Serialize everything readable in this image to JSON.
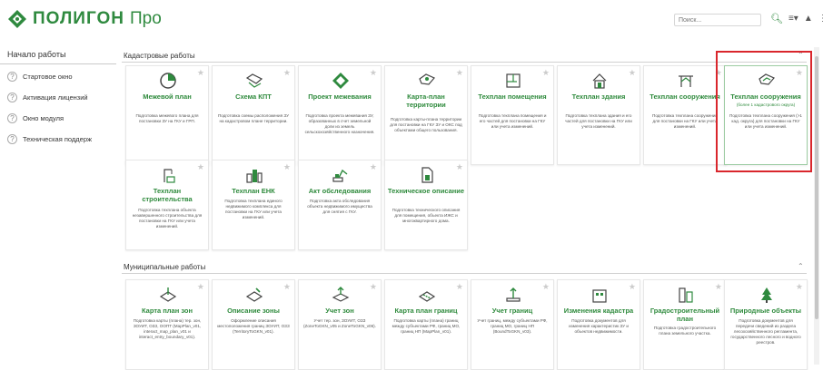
{
  "header": {
    "brand": "ПОЛИГОН",
    "brand_suffix": "Про",
    "search_placeholder": "Поиск...",
    "colors": {
      "brand": "#2f8a3f",
      "highlight": "#d9262c"
    }
  },
  "sidebar": {
    "title": "Начало работы",
    "items": [
      {
        "label": "Стартовое окно"
      },
      {
        "label": "Активация лицензий"
      },
      {
        "label": "Окно модуля"
      },
      {
        "label": "Техническая поддерж"
      }
    ]
  },
  "sections": {
    "cadastral": {
      "title": "Кадастровые работы",
      "cards": [
        {
          "title": "Межевой план",
          "desc": "Подготовка межевого плана для постановки ЗУ на ГКУ и ГРП.",
          "icon": "pie-chart-icon"
        },
        {
          "title": "Схема КПТ",
          "desc": "Подготовка схемы расположения ЗУ на кадастровом плане территории.",
          "icon": "map-icon"
        },
        {
          "title": "Проект межевания",
          "desc": "Подготовка проекта межевания ЗУ, образованных в счет земельной доли из земель сельскохозяйственного назначения.",
          "icon": "diamond-map-icon"
        },
        {
          "title": "Карта-план территории",
          "desc": "Подготовка карты-плана территории для постановки на ГКУ ЗУ и ОКС под объектами общего пользования.",
          "icon": "territory-map-icon"
        },
        {
          "title": "Техплан помещения",
          "desc": "Подготовка техплана помещения и его частей для постановки на ГКУ или учета изменений.",
          "icon": "room-plan-icon"
        },
        {
          "title": "Техплан здания",
          "desc": "Подготовка техплана здания и его частей для постановки на ГКУ или учета изменений.",
          "icon": "house-icon"
        },
        {
          "title": "Техплан сооружения",
          "desc": "Подготовка техплана сооружения для постановки на ГКУ или учета изменений.",
          "icon": "structure-icon"
        },
        {
          "title": "Техплан сооружения",
          "subtitle": "(более 1 кадастрового округа)",
          "desc": "Подготовка техплана сооружения (>1 кад. округа) для постановки на ГКУ или учета изменений.",
          "icon": "map-multi-icon"
        },
        {
          "title": "Техплан строительства",
          "desc": "Подготовка техплана объекта незавершенного строительства для постановки на ГКУ или учета изменений.",
          "icon": "construction-icon"
        },
        {
          "title": "Техплан ЕНК",
          "desc": "Подготовка техплана единого недвижимого комплекса для постановки на ГКУ или учета изменений.",
          "icon": "complex-icon"
        },
        {
          "title": "Акт обследования",
          "desc": "Подготовка акта обследования объекта недвижимого имущества для снятия с ГКУ.",
          "icon": "excavator-icon"
        },
        {
          "title": "Техническое описание",
          "desc": "Подготовка технического описания для помещения, объекта ИЖС и многоквартирного дома.",
          "icon": "document-icon"
        }
      ]
    },
    "municipal": {
      "title": "Муниципальные работы",
      "cards": [
        {
          "title": "Карта план зон",
          "desc": "Подготовка карты (плана) тер. зон, ЗОУИТ, ОЗЗ, ООПТ (MapPlan_v01, interact_map_plan_v01 и interact_entry_boundary_v01).",
          "icon": "zone-map-icon"
        },
        {
          "title": "Описание зоны",
          "desc": "Оформление описания местоположения границ ЗОУИТ, ОЗЗ (TerritoryToGKN_v01).",
          "icon": "zone-desc-icon"
        },
        {
          "title": "Учет зон",
          "desc": "Учет тер. зон, ЗОУИТ, ОЗЗ (ZoneToGKN_v05 и ZoneToGKN_v06).",
          "icon": "zone-register-icon"
        },
        {
          "title": "Карта план границ",
          "desc": "Подготовка карты (плана) границ между субъектами РФ, границ МО, границ НП (MapPlan_v01).",
          "icon": "border-map-icon"
        },
        {
          "title": "Учет границ",
          "desc": "Учет границ, между субъектами РФ, границ МО, границ НП (BoundToGKN_v03).",
          "icon": "border-register-icon"
        },
        {
          "title": "Изменения кадастра",
          "desc": "Подготовка документов для изменения характеристик ЗУ и объектов недвижимости.",
          "icon": "building-icon"
        },
        {
          "title": "Градостроительный план",
          "desc": "Подготовка градостроительного плана земельного участка.",
          "icon": "city-plan-icon"
        },
        {
          "title": "Природные объекты",
          "desc": "Подготовка документов для передачи сведений из раздела лесохозяйственного регламента, государственного лесного и водного реестров.",
          "icon": "nature-icon"
        }
      ]
    }
  }
}
